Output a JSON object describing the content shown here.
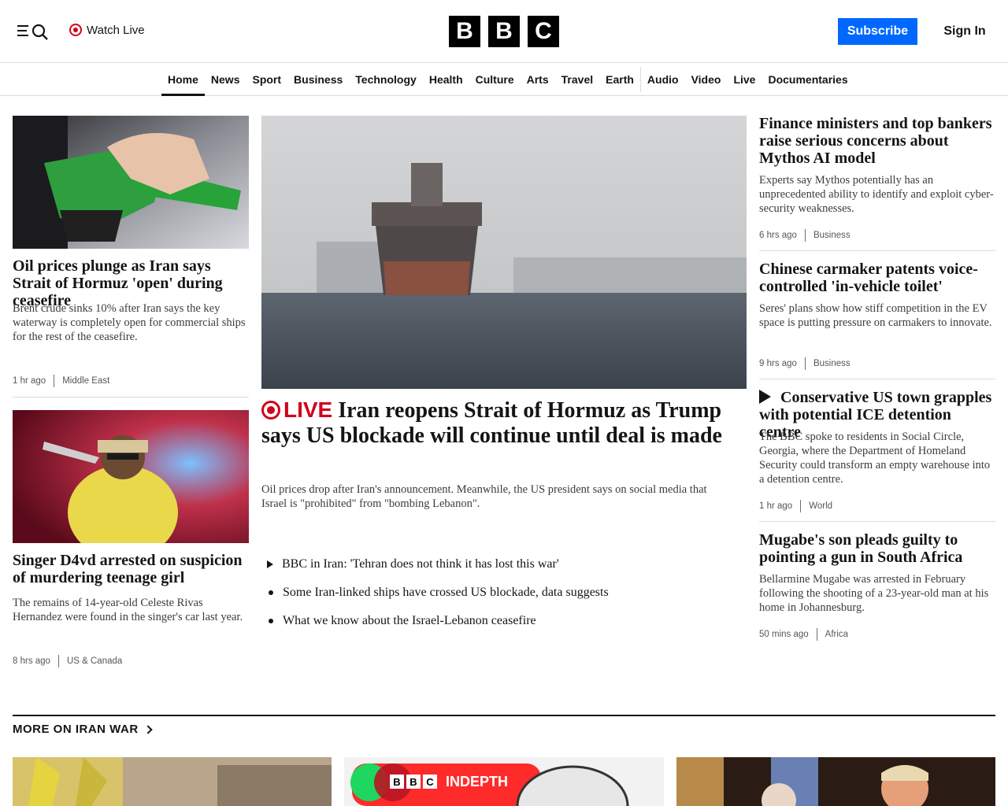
{
  "header": {
    "watch_live": "Watch Live",
    "logo_letters": [
      "B",
      "B",
      "C"
    ],
    "subscribe": "Subscribe",
    "sign_in": "Sign In"
  },
  "nav": {
    "items": [
      "Home",
      "News",
      "Sport",
      "Business",
      "Technology",
      "Health",
      "Culture",
      "Arts",
      "Travel",
      "Earth",
      "Audio",
      "Video",
      "Live",
      "Documentaries"
    ],
    "active": "Home"
  },
  "left": [
    {
      "headline": "Oil prices plunge as Iran says Strait of Hormuz 'open' during ceasefire",
      "summary": "Brent crude sinks 10% after Iran says the key waterway is completely open for commercial ships for the rest of the ceasefire.",
      "time": "1 hr ago",
      "section": "Middle East"
    },
    {
      "headline": "Singer D4vd arrested on suspicion of murdering teenage girl",
      "summary": "The remains of 14-year-old Celeste Rivas Hernandez were found in the singer's car last year.",
      "time": "8 hrs ago",
      "section": "US & Canada"
    }
  ],
  "lead": {
    "live_label": "LIVE",
    "headline": "Iran reopens Strait of Hormuz as Trump says US blockade will continue until deal is made",
    "summary": "Oil prices drop after Iran's announcement. Meanwhile, the US president says on social media that Israel is \"prohibited\" from \"bombing Lebanon\".",
    "related": [
      {
        "text": "BBC in Iran: 'Tehran does not think it has lost this war'",
        "icon": "play-icon"
      },
      {
        "text": "Some Iran-linked ships have crossed US blockade, data suggests",
        "icon": "bullet"
      },
      {
        "text": "What we know about the Israel-Lebanon ceasefire",
        "icon": "bullet"
      }
    ]
  },
  "right": [
    {
      "headline": "Finance ministers and top bankers raise serious concerns about Mythos AI model",
      "summary": "Experts say Mythos potentially has an unprecedented ability to identify and exploit cyber-security weaknesses.",
      "time": "6 hrs ago",
      "section": "Business"
    },
    {
      "headline": "Chinese carmaker patents voice-controlled 'in-vehicle toilet'",
      "summary": "Seres' plans show how stiff competition in the EV space is putting pressure on carmakers to innovate.",
      "time": "9 hrs ago",
      "section": "Business"
    },
    {
      "headline": "Conservative US town grapples with potential ICE detention centre",
      "summary": "The BBC spoke to residents in Social Circle, Georgia, where the Department of Homeland Security could transform an empty warehouse into a detention centre.",
      "time": "1 hr ago",
      "section": "World"
    },
    {
      "headline": "Mugabe's son pleads guilty to pointing a gun in South Africa",
      "summary": "Bellarmine Mugabe was arrested in February following the shooting of a 23-year-old man at his home in Johannesburg.",
      "time": "50 mins ago",
      "section": "Africa"
    }
  ],
  "more": {
    "title": "MORE ON IRAN WAR",
    "indepth_badge": [
      "B",
      "B",
      "C"
    ],
    "indepth_label": "INDEPTH"
  }
}
